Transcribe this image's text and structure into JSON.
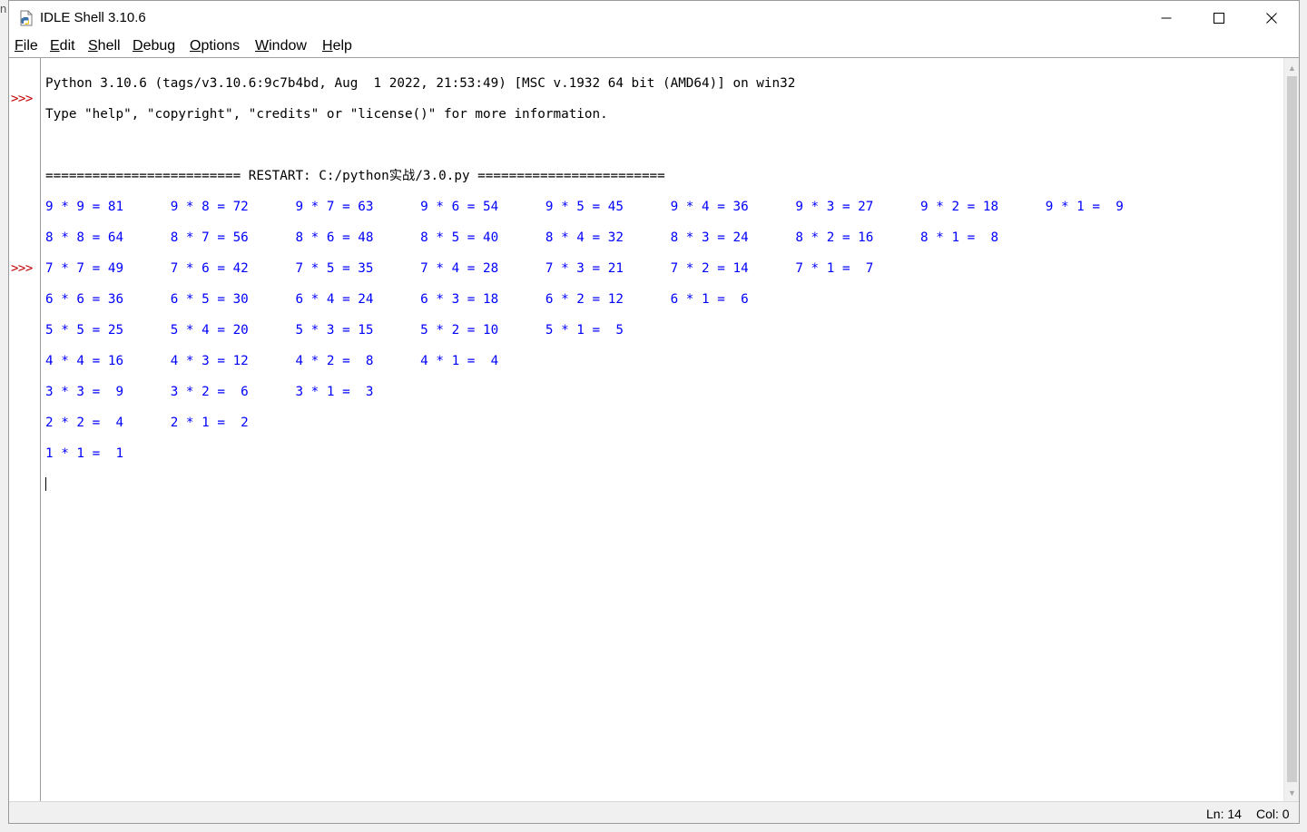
{
  "window": {
    "title": "IDLE Shell 3.10.6",
    "icon": "python-idle-icon"
  },
  "menu": [
    {
      "label": "File",
      "mnemonic": "F",
      "rest": "ile"
    },
    {
      "label": "Edit",
      "mnemonic": "E",
      "rest": "dit"
    },
    {
      "label": "Shell",
      "mnemonic": "S",
      "rest": "hell"
    },
    {
      "label": "Debug",
      "mnemonic": "D",
      "rest": "ebug"
    },
    {
      "label": "Options",
      "mnemonic": "O",
      "rest": "ptions"
    },
    {
      "label": "Window",
      "mnemonic": "W",
      "rest": "indow"
    },
    {
      "label": "Help",
      "mnemonic": "H",
      "rest": "elp"
    }
  ],
  "shell": {
    "prompt": ">>>",
    "banner": [
      "Python 3.10.6 (tags/v3.10.6:9c7b4bd, Aug  1 2022, 21:53:49) [MSC v.1932 64 bit (AMD64)] on win32",
      "Type \"help\", \"copyright\", \"credits\" or \"license()\" for more information."
    ],
    "restart_line": "========================= RESTART: C:/python实战/3.0.py ========================",
    "output_lines": [
      "9 * 9 = 81      9 * 8 = 72      9 * 7 = 63      9 * 6 = 54      9 * 5 = 45      9 * 4 = 36      9 * 3 = 27      9 * 2 = 18      9 * 1 =  9",
      "8 * 8 = 64      8 * 7 = 56      8 * 6 = 48      8 * 5 = 40      8 * 4 = 32      8 * 3 = 24      8 * 2 = 16      8 * 1 =  8",
      "7 * 7 = 49      7 * 6 = 42      7 * 5 = 35      7 * 4 = 28      7 * 3 = 21      7 * 2 = 14      7 * 1 =  7",
      "6 * 6 = 36      6 * 5 = 30      6 * 4 = 24      6 * 3 = 18      6 * 2 = 12      6 * 1 =  6",
      "5 * 5 = 25      5 * 4 = 20      5 * 3 = 15      5 * 2 = 10      5 * 1 =  5",
      "4 * 4 = 16      4 * 3 = 12      4 * 2 =  8      4 * 1 =  4",
      "3 * 3 =  9      3 * 2 =  6      3 * 1 =  3",
      "2 * 2 =  4      2 * 1 =  2",
      "1 * 1 =  1"
    ]
  },
  "status": {
    "line": "Ln: 14",
    "col": "Col: 0"
  },
  "colors": {
    "prompt": "#c00000",
    "output": "#0000ff",
    "stdout": "#000000"
  }
}
